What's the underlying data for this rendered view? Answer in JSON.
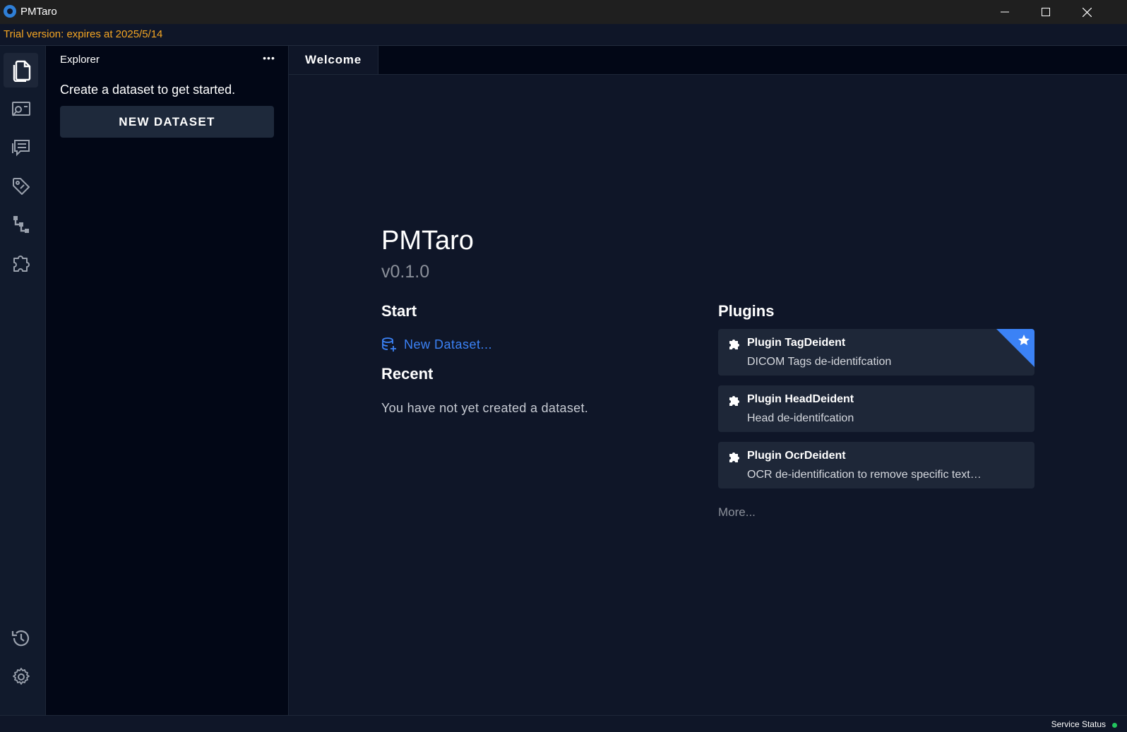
{
  "window": {
    "title": "PMTaro",
    "controls": [
      "minimize-icon",
      "maximize-icon",
      "close-icon"
    ]
  },
  "trial": {
    "text": "Trial version: expires at 2025/5/14",
    "color": "#f5a623"
  },
  "activity_bar": {
    "items": [
      {
        "icon": "files-icon",
        "active": true
      },
      {
        "icon": "image-viewer-icon",
        "active": false
      },
      {
        "icon": "comments-icon",
        "active": false
      },
      {
        "icon": "tag-icon",
        "active": false
      },
      {
        "icon": "workflow-icon",
        "active": false
      },
      {
        "icon": "puzzle-icon",
        "active": false
      }
    ],
    "bottom_items": [
      {
        "icon": "history-icon"
      },
      {
        "icon": "gear-icon"
      }
    ]
  },
  "explorer": {
    "title": "Explorer",
    "more_label": "•••",
    "hint": "Create a dataset to get started.",
    "new_dataset_label": "NEW DATASET"
  },
  "tabs": [
    {
      "label": "Welcome",
      "active": true
    }
  ],
  "welcome": {
    "app_name": "PMTaro",
    "version": "v0.1.0",
    "start_title": "Start",
    "start_link": "New Dataset...",
    "recent_title": "Recent",
    "recent_empty": "You have not yet created a dataset.",
    "plugins_title": "Plugins",
    "plugins": [
      {
        "name": "Plugin TagDeident",
        "description": "DICOM Tags de-identifcation",
        "starred": true
      },
      {
        "name": "Plugin HeadDeident",
        "description": "Head de-identifcation",
        "starred": false
      },
      {
        "name": "Plugin OcrDeident",
        "description": "OCR de-identification to remove specific text…",
        "starred": false
      }
    ],
    "more_label": "More..."
  },
  "status_bar": {
    "service_status_label": "Service Status",
    "service_status_color": "#22c55e"
  },
  "colors": {
    "accent": "#3b82f6",
    "background": "#0f1628",
    "panel": "#020716",
    "card": "#1e2738"
  }
}
